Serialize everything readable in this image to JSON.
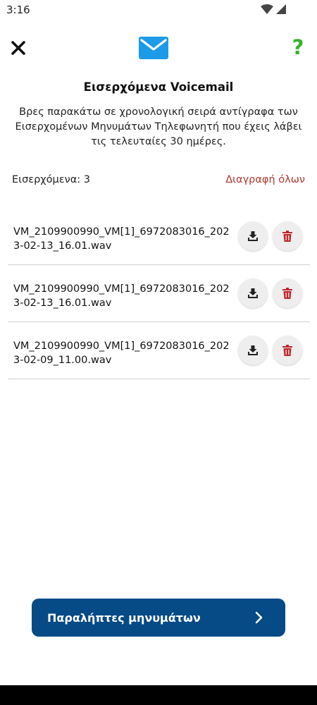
{
  "status_bar": {
    "time": "3:16"
  },
  "header": {
    "close_icon": "close-icon",
    "mail_icon": "mail-icon",
    "help_label": "?",
    "accent_color": "#37b32f"
  },
  "title": "Εισερχόμενα Voicemail",
  "description": "Βρες παρακάτω σε χρονολογική σειρά αντίγραφα των Εισερχομένων Μηνυμάτων Τηλεφωνητή που έχεις λάβει τις τελευταίες 30 ημέρες.",
  "inbox": {
    "count_label": "Εισερχόμενα: 3",
    "delete_all_label": "Διαγραφή όλων",
    "delete_color": "#b0382f"
  },
  "files": [
    {
      "name": "VM_2109900990_VM[1]_6972083016_2023-02-13_16.01.wav"
    },
    {
      "name": "VM_2109900990_VM[1]_6972083016_2023-02-13_16.01.wav"
    },
    {
      "name": "VM_2109900990_VM[1]_6972083016_2023-02-09_11.00.wav"
    }
  ],
  "footer": {
    "recipients_label": "Παραλήπτες μηνυμάτων",
    "button_color": "#064a86"
  }
}
